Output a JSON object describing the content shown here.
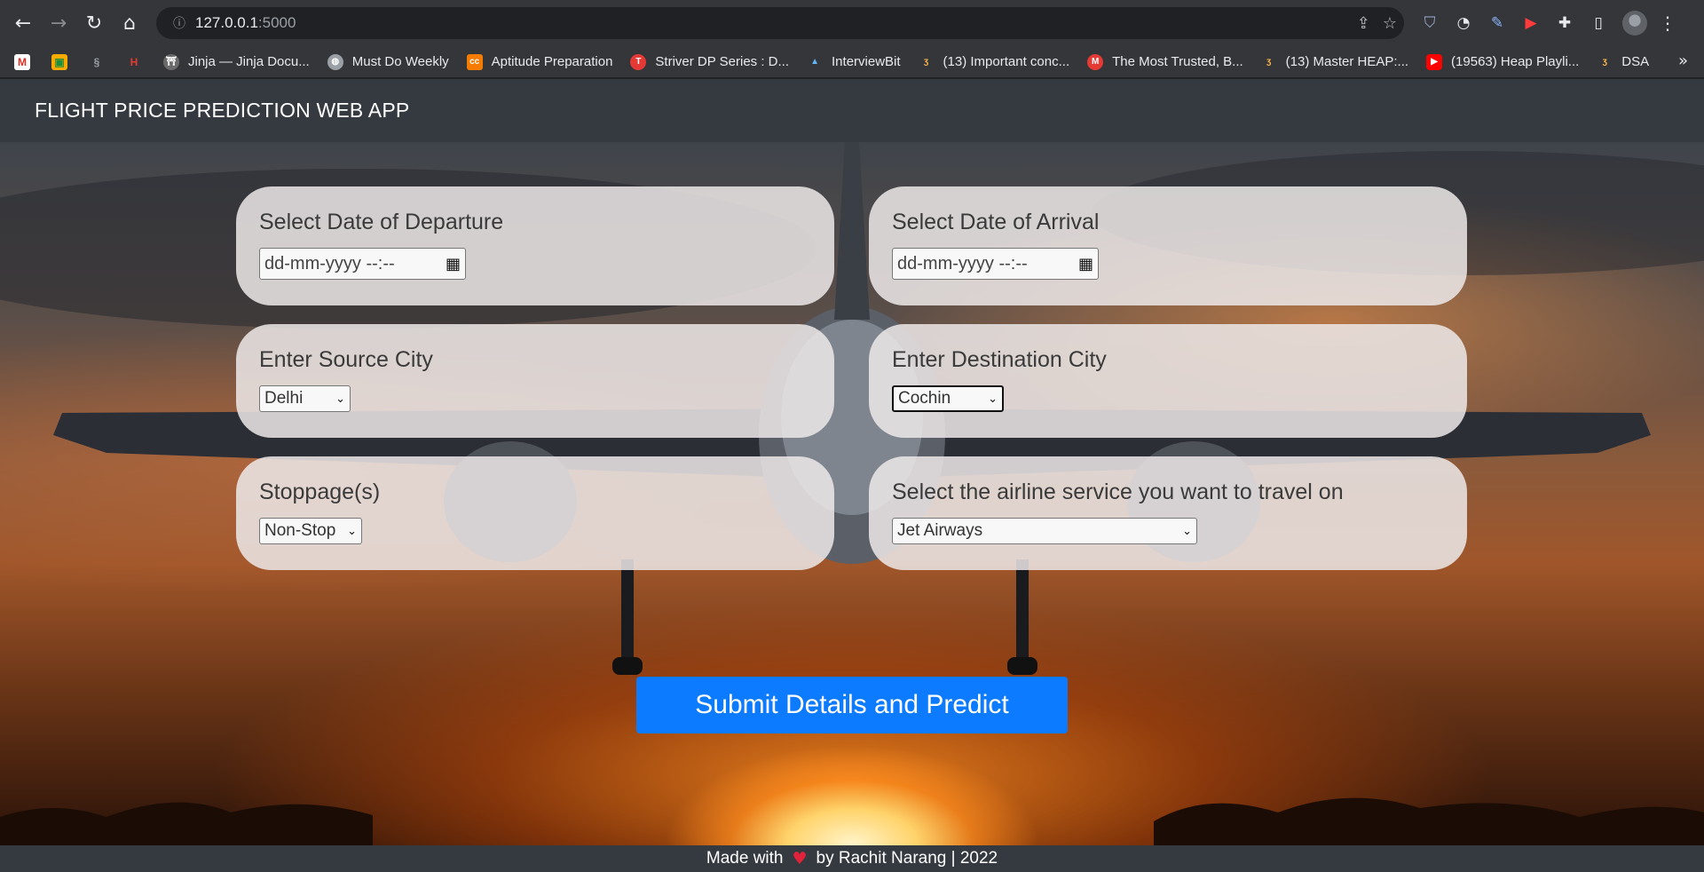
{
  "browser": {
    "url_host": "127.0.0.1",
    "url_port": ":5000",
    "icons": {
      "back": "arrow-left-icon",
      "forward": "arrow-right-icon",
      "reload": "reload-icon",
      "home": "home-icon",
      "info": "info-icon",
      "share": "share-icon",
      "bookmark": "star-icon",
      "menu": "kebab-menu-icon"
    }
  },
  "bookmarks": [
    {
      "label": "Jinja — Jinja Docu...",
      "icon": "jinja-icon",
      "color": "#6b6b6b"
    },
    {
      "label": "Must Do Weekly",
      "icon": "globe-icon",
      "color": "#9aa0a6"
    },
    {
      "label": "Aptitude Preparation",
      "icon": "cc-icon",
      "color": "#f57c00"
    },
    {
      "label": "Striver DP Series : D...",
      "icon": "tuf-icon",
      "color": "#e53935"
    },
    {
      "label": "InterviewBit",
      "icon": "interviewbit-icon",
      "color": "#64b5f6"
    },
    {
      "label": "(13) Important conc...",
      "icon": "codestudio-icon",
      "color": "#ffb74d"
    },
    {
      "label": "The Most Trusted, B...",
      "icon": "m-icon",
      "color": "#e53935"
    },
    {
      "label": "(13) Master HEAP:...",
      "icon": "codestudio-icon",
      "color": "#ffb74d"
    },
    {
      "label": "(19563) Heap Playli...",
      "icon": "youtube-icon",
      "color": "#ff0000"
    },
    {
      "label": "DSA",
      "icon": "codestudio-icon",
      "color": "#ffb74d"
    }
  ],
  "app": {
    "brand": "FLIGHT PRICE PREDICTION WEB APP",
    "fields": {
      "departure": {
        "label": "Select Date of Departure",
        "placeholder": "dd-mm-yyyy  --:--"
      },
      "arrival": {
        "label": "Select Date of Arrival",
        "placeholder": "dd-mm-yyyy  --:--"
      },
      "source": {
        "label": "Enter Source City",
        "value": "Delhi"
      },
      "destination": {
        "label": "Enter Destination City",
        "value": "Cochin"
      },
      "stoppage": {
        "label": "Stoppage(s)",
        "value": "Non-Stop"
      },
      "airline": {
        "label": "Select the airline service you want to travel on",
        "value": "Jet Airways"
      }
    },
    "submit_label": "Submit Details and Predict",
    "footer": {
      "prefix": "Made with",
      "suffix": "by Rachit Narang | 2022"
    }
  },
  "colors": {
    "navbar": "#343a40",
    "submit": "#0d7bff",
    "heart": "#e0223a"
  }
}
